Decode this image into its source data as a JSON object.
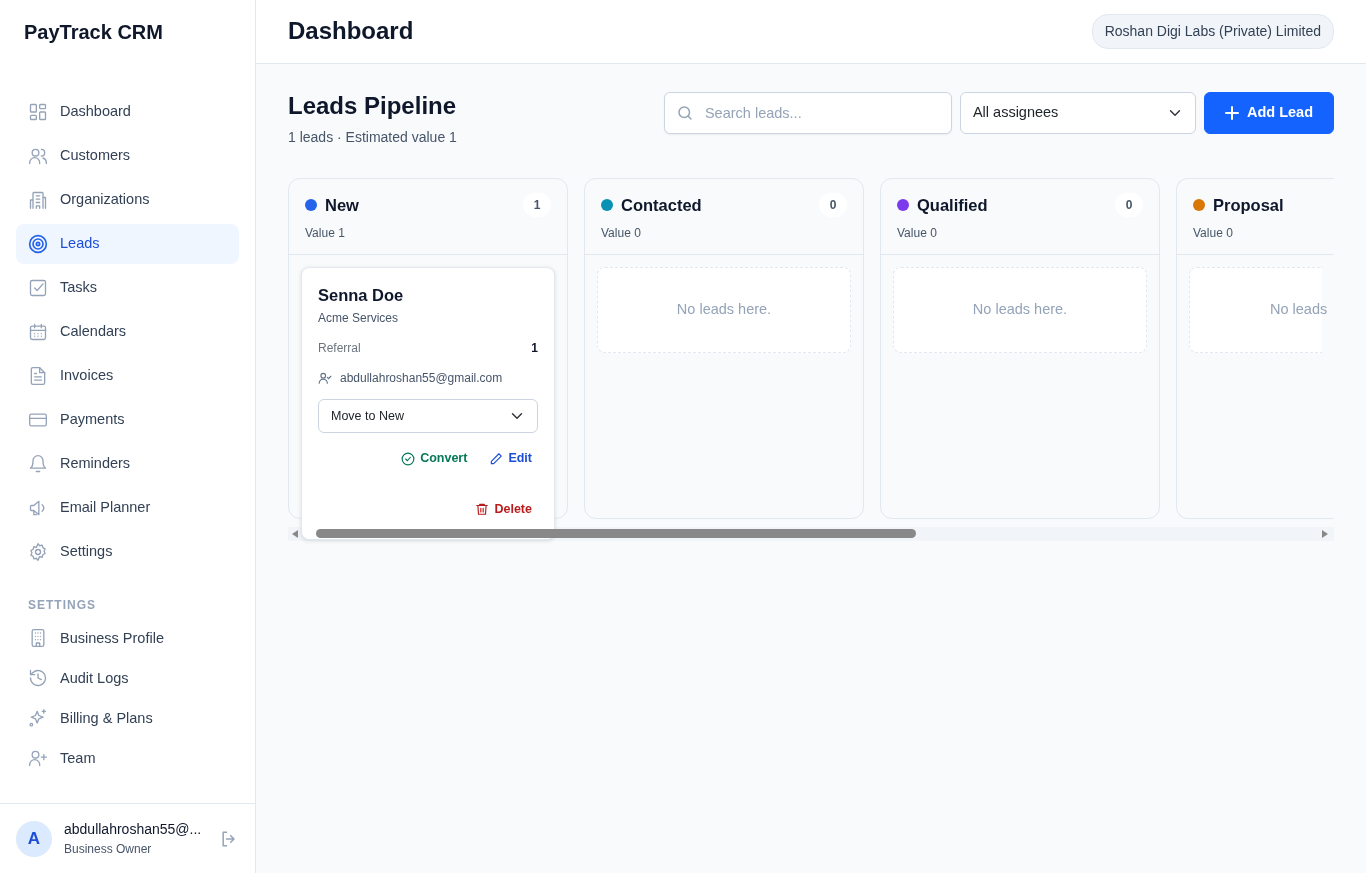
{
  "brand": "PayTrack CRM",
  "nav": [
    {
      "label": "Dashboard",
      "selected": false
    },
    {
      "label": "Customers",
      "selected": false
    },
    {
      "label": "Organizations",
      "selected": false
    },
    {
      "label": "Leads",
      "selected": true
    },
    {
      "label": "Tasks",
      "selected": false
    },
    {
      "label": "Calendars",
      "selected": false
    },
    {
      "label": "Invoices",
      "selected": false
    },
    {
      "label": "Payments",
      "selected": false
    },
    {
      "label": "Reminders",
      "selected": false
    },
    {
      "label": "Email Planner",
      "selected": false
    },
    {
      "label": "Settings",
      "selected": false
    }
  ],
  "settings_heading": "SETTINGS",
  "settings_nav": [
    {
      "label": "Business Profile",
      "selected": false
    },
    {
      "label": "Audit Logs",
      "selected": false
    },
    {
      "label": "Billing & Plans",
      "selected": false
    },
    {
      "label": "Team",
      "selected": false
    }
  ],
  "user": {
    "initial": "A",
    "email": "abdullahroshan55@...",
    "role": "Business Owner"
  },
  "header": {
    "title": "Dashboard",
    "org": "Roshan Digi Labs (Private) Limited"
  },
  "pipeline": {
    "title": "Leads Pipeline",
    "summary": "1 leads · Estimated value 1",
    "search": {
      "placeholder": "Search leads..."
    },
    "assignee_select": "All assignees",
    "add_button": "Add Lead",
    "columns": [
      {
        "name": "New",
        "color": "#2563eb",
        "count": "1",
        "value_label": "Value",
        "value": "1",
        "leads": [
          {
            "name": "Senna Doe",
            "company": "Acme Services",
            "source": "Referral",
            "amount": "1",
            "assignee": "abdullahroshan55@gmail.com",
            "move_select": "Move to New",
            "actions": [
              {
                "kind": "convert",
                "label": "Convert"
              },
              {
                "kind": "edit",
                "label": "Edit"
              },
              {
                "kind": "delete",
                "label": "Delete"
              }
            ]
          }
        ]
      },
      {
        "name": "Contacted",
        "color": "#0891b2",
        "count": "0",
        "value_label": "Value",
        "value": "0",
        "empty_text": "No leads here."
      },
      {
        "name": "Qualified",
        "color": "#7c3aed",
        "count": "0",
        "value_label": "Value",
        "value": "0",
        "empty_text": "No leads here."
      },
      {
        "name": "Proposal",
        "color": "#d97706",
        "value_label": "Value",
        "value": "0",
        "empty_text": "No leads"
      }
    ]
  }
}
